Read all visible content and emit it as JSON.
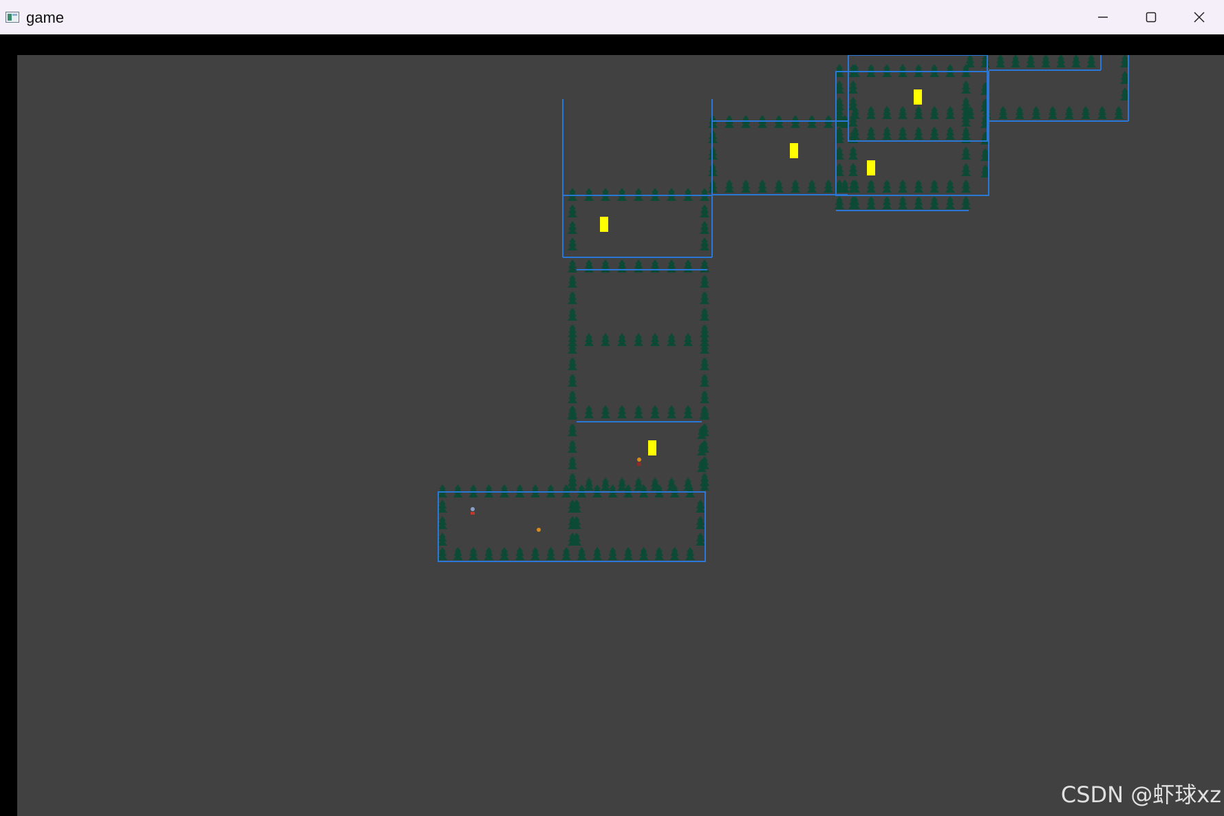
{
  "window": {
    "title": "game",
    "controls": {
      "minimize": "minimize-icon",
      "maximize": "maximize-icon",
      "close": "close-icon"
    }
  },
  "watermark": "CSDN @虾球xz",
  "colors": {
    "game_background": "#414141",
    "outline": "#2a78d6",
    "tree": "#0d4a35",
    "marker": "#ffff00"
  }
}
